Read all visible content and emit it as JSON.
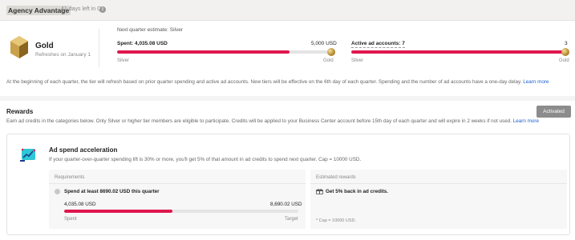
{
  "header": {
    "title": "Agency Advantage",
    "days_left": "41 days left in Q4",
    "info_icon": "info-icon"
  },
  "tier": {
    "name": "Gold",
    "subtitle": "Refreshes on January 1",
    "icon": "gold-tier-icon"
  },
  "next_quarter_estimate": "Next quarter estimate: Silver",
  "spent_metric": {
    "label": "Spent: 4,035.08 USD",
    "max_label": "5,000 USD",
    "progress_fraction": 0.807,
    "start_label": "Silver",
    "end_label": "Gold"
  },
  "accounts_metric": {
    "label": "Active ad accounts: 7",
    "max_label": "3",
    "progress_fraction": 1.0,
    "start_label": "Silver",
    "end_label": "Gold"
  },
  "tier_note": {
    "text": "At the beginning of each quarter, the tier will refresh based on prior quarter spending and active ad accounts. New tiers will be effective on the 6th day of each quarter. Spending and the number of ad accounts have a one-day delay.",
    "link": "Learn more"
  },
  "rewards": {
    "title": "Rewards",
    "status_button": "Activated",
    "description": "Earn ad credits in the categories below. Only Silver or higher tier members are eligible to participate. Credits will be applied to your Business Center account before 15th day of each quarter and will expire in 2 weeks if not used.",
    "link": "Learn more"
  },
  "card": {
    "icon": "chart-growth-icon",
    "title": "Ad spend acceleration",
    "description": "If your quarter-over-quarter spending lift is 30% or more, you'll get 5% of that amount in ad credits to spend next quarter. Cap = 10000 USD.",
    "requirements": {
      "header": "Requirements",
      "item": "Spend at least 8690.02 USD this quarter",
      "current": "4,035.08 USD",
      "target": "8,690.02 USD",
      "progress_fraction": 0.464,
      "spent_label": "Spent",
      "target_label": "Target"
    },
    "estimated": {
      "header": "Estimated rewards",
      "item": "Get 5% back in ad credits.",
      "cap_note": "* Cap = 10000 USD."
    }
  },
  "colors": {
    "accent": "#e0174e",
    "gold": "#b78a2e",
    "button_gray": "#8c8c8c"
  }
}
